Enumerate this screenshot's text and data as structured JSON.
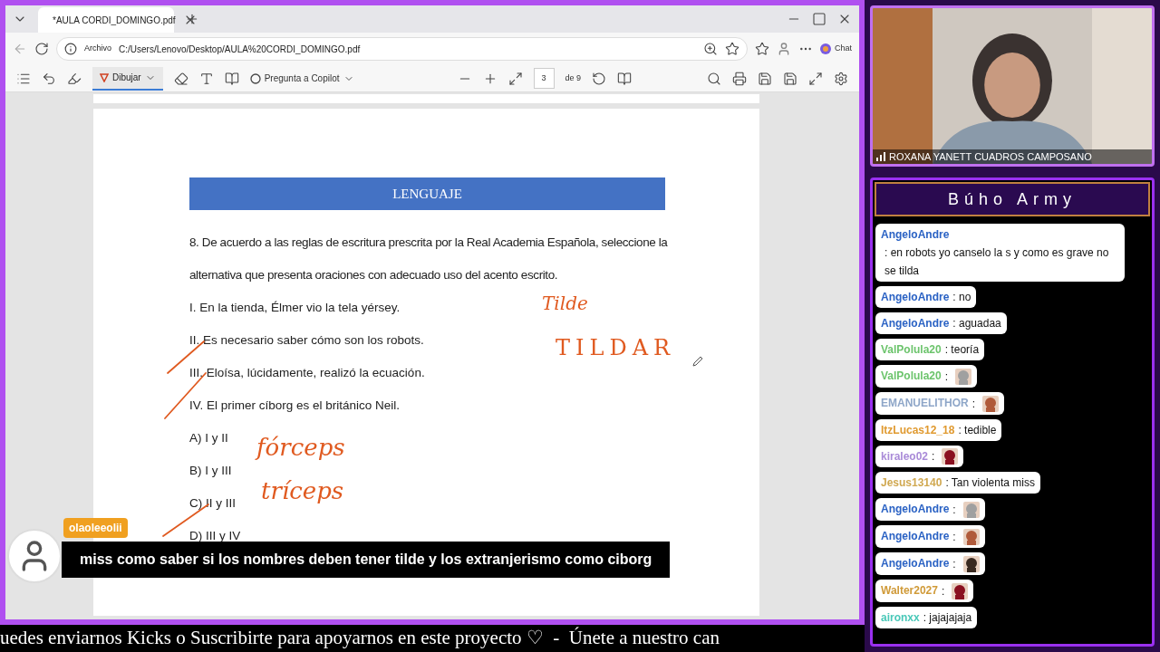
{
  "browser": {
    "tab": {
      "title": "*AULA CORDI_DOMINGO.pdf"
    },
    "address": {
      "label": "Archivo",
      "url": "C:/Users/Lenovo/Desktop/AULA%20CORDI_DOMINGO.pdf"
    },
    "chat_button": "Chat",
    "toolbar": {
      "draw": "Dibujar",
      "copilot": "Pregunta a Copilot",
      "page": "3",
      "page_total": "de 9"
    }
  },
  "document": {
    "banner": "LENGUAJE",
    "question": "8. De acuerdo a las reglas de escritura prescrita por la Real Academia Española, seleccione la alternativa que presenta oraciones con adecuado uso del acento escrito.",
    "statements": [
      "I. En la tienda, Élmer vio la tela yérsey.",
      "II. Es necesario saber cómo son los robots.",
      "III. Eloísa, lúcidamente, realizó la ecuación.",
      "IV. El primer cíborg es el británico Neil."
    ],
    "options": [
      "A) I y II",
      "B) I y III",
      "C) II y III",
      "D) III y IV"
    ],
    "ink": [
      "Tilde",
      "TILDAR",
      "fórceps",
      "tríceps"
    ]
  },
  "caption": {
    "user": "olaoleeolii",
    "message": "miss como saber si los nombres deben tener tilde y los extranjerismo como ciborg"
  },
  "webcam": {
    "name": "ROXANA YANETT CUADROS CAMPOSANO"
  },
  "chat": {
    "title": "Búho Army",
    "messages": [
      {
        "user": "AngeloAndre",
        "color": "#2a62c4",
        "kind": "text",
        "text": ": en robots yo canselo la s y como es grave no se tilda"
      },
      {
        "user": "AngeloAndre",
        "color": "#2a62c4",
        "kind": "text",
        "text": ": no"
      },
      {
        "user": "AngeloAndre",
        "color": "#2a62c4",
        "kind": "text",
        "text": ": aguadaa"
      },
      {
        "user": "ValPolula20",
        "color": "#6cc46c",
        "kind": "text",
        "text": ": teoría"
      },
      {
        "user": "ValPolula20",
        "color": "#6cc46c",
        "kind": "emote",
        "text": ":"
      },
      {
        "user": "EMANUELITHOR",
        "color": "#8ea6c8",
        "kind": "emote",
        "text": ":"
      },
      {
        "user": "ItzLucas12_18",
        "color": "#e09a30",
        "kind": "text",
        "text": ": tedible"
      },
      {
        "user": "kiraleo02",
        "color": "#a98ad8",
        "kind": "emote",
        "text": ":"
      },
      {
        "user": "Jesus13140",
        "color": "#d0a850",
        "kind": "text",
        "text": ": Tan violenta miss"
      },
      {
        "user": "AngeloAndre",
        "color": "#2a62c4",
        "kind": "emote",
        "text": ":"
      },
      {
        "user": "AngeloAndre",
        "color": "#2a62c4",
        "kind": "emote",
        "text": ":"
      },
      {
        "user": "AngeloAndre",
        "color": "#2a62c4",
        "kind": "emote",
        "text": ":"
      },
      {
        "user": "Walter2027",
        "color": "#d09a38",
        "kind": "emote",
        "text": ":"
      },
      {
        "user": "aironxx",
        "color": "#48c8b8",
        "kind": "text",
        "text": ": jajajajaja"
      }
    ]
  },
  "ticker": "uedes enviarnos Kicks o Suscribirte para apoyarnos en este proyecto ♡  -  Únete a nuestro can"
}
